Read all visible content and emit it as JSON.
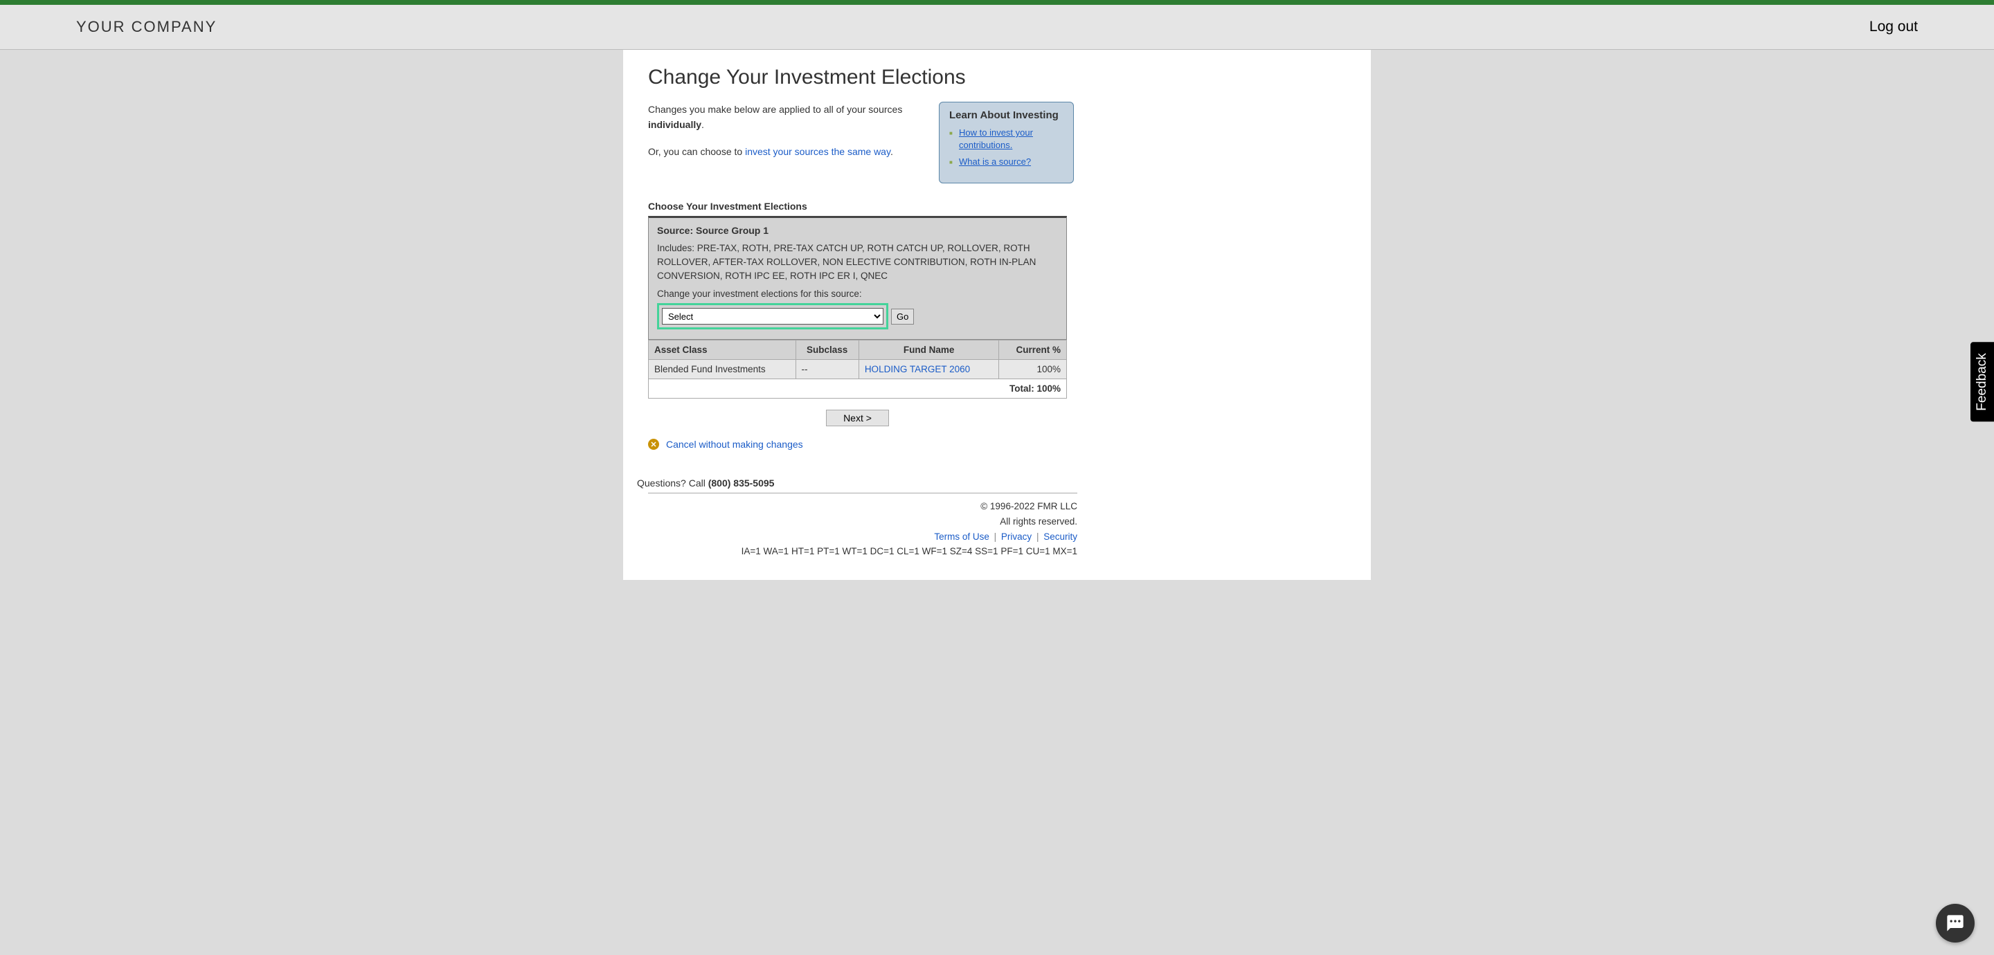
{
  "header": {
    "company": "YOUR COMPANY",
    "logout": "Log out"
  },
  "page": {
    "title": "Change Your Investment Elections",
    "intro_prefix": "Changes you make below are applied to all of your sources ",
    "intro_bold": "individually",
    "intro_suffix": ".",
    "alt_prefix": "Or, you can choose to ",
    "alt_link": "invest your sources the same way",
    "alt_suffix": "."
  },
  "learn": {
    "title": "Learn About Investing",
    "links": [
      "How to invest your contributions.",
      "What is a source?"
    ]
  },
  "section": {
    "label": "Choose Your Investment Elections",
    "source_label": "Source: Source Group 1",
    "includes": "Includes: PRE-TAX, ROTH, PRE-TAX CATCH UP, ROTH CATCH UP, ROLLOVER, ROTH ROLLOVER, AFTER-TAX ROLLOVER, NON ELECTIVE CONTRIBUTION, ROTH IN-PLAN CONVERSION, ROTH IPC EE, ROTH IPC ER I, QNEC",
    "change_label": "Change your investment elections for this source:",
    "select_value": "Select",
    "go": "Go"
  },
  "table": {
    "headers": {
      "asset_class": "Asset Class",
      "subclass": "Subclass",
      "fund_name": "Fund Name",
      "current_pct": "Current %"
    },
    "rows": [
      {
        "asset_class": "Blended Fund Investments",
        "subclass": "--",
        "fund_name": "HOLDING TARGET 2060",
        "current_pct": "100%"
      }
    ],
    "total_label": "Total: 100%"
  },
  "actions": {
    "next": "Next >",
    "cancel": "Cancel without making changes"
  },
  "footer": {
    "questions_prefix": "Questions?  Call ",
    "phone": "(800) 835-5095",
    "copyright": "© 1996-2022 FMR LLC",
    "rights": "All rights reserved.",
    "terms": "Terms of Use",
    "privacy": "Privacy",
    "security": "Security",
    "debug": "IA=1 WA=1 HT=1 PT=1 WT=1 DC=1 CL=1 WF=1 SZ=4 SS=1 PF=1 CU=1 MX=1"
  },
  "side": {
    "feedback": "Feedback"
  }
}
